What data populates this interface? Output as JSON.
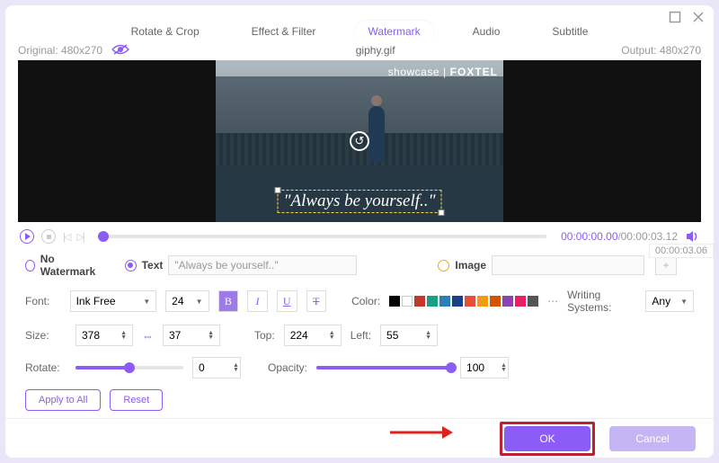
{
  "window": {
    "filename": "giphy.gif"
  },
  "resolution": {
    "original_label": "Original:",
    "original": "480x270",
    "output_label": "Output:",
    "output": "480x270"
  },
  "tabs": [
    "Rotate & Crop",
    "Effect & Filter",
    "Watermark",
    "Audio",
    "Subtitle"
  ],
  "preview": {
    "badge_left": "showcase",
    "badge_right": "FOXTEL",
    "watermark_text": "\"Always be yourself..\""
  },
  "playback": {
    "current": "00:00:00.00",
    "total": "00:00:03.12",
    "slider_end_label": "00:00:03.06"
  },
  "watermark_mode": {
    "none": "No Watermark",
    "text": "Text",
    "text_value": "\"Always be yourself..\"",
    "image": "Image"
  },
  "font_row": {
    "font_label": "Font:",
    "family": "Ink Free",
    "size": "24",
    "color_label": "Color:",
    "writing_label": "Writing Systems:",
    "writing_value": "Any",
    "colors": [
      "#000000",
      "#ffffff",
      "#c0392b",
      "#16a085",
      "#2980b9",
      "#1b3f8b",
      "#e74c3c",
      "#f39c12",
      "#d35400",
      "#8e44ad",
      "#e91e63",
      "#555555"
    ]
  },
  "size_row": {
    "label": "Size:",
    "w": "378",
    "h": "37",
    "top_label": "Top:",
    "top": "224",
    "left_label": "Left:",
    "left": "55"
  },
  "rotate_row": {
    "rotate_label": "Rotate:",
    "rotate_val": "0",
    "opacity_label": "Opacity:",
    "opacity_val": "100"
  },
  "buttons": {
    "apply_all": "Apply to All",
    "reset": "Reset",
    "ok": "OK",
    "cancel": "Cancel"
  },
  "format": {
    "bold": "B",
    "italic": "I",
    "underline": "U",
    "strike": "T"
  }
}
